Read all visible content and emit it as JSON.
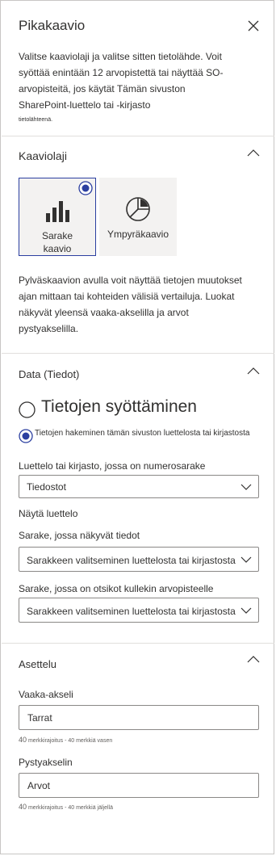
{
  "panel": {
    "title": "Pikakaavio",
    "close_icon": "close-icon",
    "intro_text": "Valitse kaaviolaji ja valitse sitten tietolähde. Voit syöttää enintään 12 arvopistettä tai näyttää SO-arvopisteitä, jos käytät Tämän sivuston SharePoint-luettelo tai -kirjasto",
    "intro_small": "tietolähteenä."
  },
  "chart_type": {
    "section_title": "Kaaviolaji",
    "options": [
      {
        "label_line1": "Sarake",
        "label_line2": "kaavio",
        "icon": "bar-chart-icon",
        "selected": true
      },
      {
        "label_line1": "Ympyräkaavio",
        "label_line2": "",
        "icon": "pie-chart-icon",
        "selected": false
      }
    ],
    "description": "Pylväskaavion avulla voit näyttää tietojen muutokset ajan mittaan tai kohteiden välisiä vertailuja. Luokat näkyvät yleensä vaaka-akselilla ja arvot pystyakselilla."
  },
  "data": {
    "section_title": "Data (Tiedot)",
    "radio_manual": "Tietojen syöttäminen",
    "radio_list": "Tietojen hakeminen tämän sivuston luettelosta tai kirjastosta",
    "list_label": "Luettelo tai kirjasto, jossa on numerosarake",
    "list_value": "Tiedostot",
    "show_list": "Näytä luettelo",
    "column_data_label": "Sarake, jossa näkyvät tiedot",
    "column_data_value": "Sarakkeen valitseminen luettelosta tai kirjastosta",
    "column_labels_label": "Sarake, jossa on otsikot kullekin arvopisteelle",
    "column_labels_value": "Sarakkeen valitseminen luettelosta tai kirjastosta"
  },
  "layout": {
    "section_title": "Asettelu",
    "x_axis_label": "Vaaka-akseli",
    "x_axis_value": "Tarrat",
    "x_counter_num": "40",
    "x_counter_text": "merkkirajoitus - 40 merkkiä vasen",
    "y_axis_label": "Pystyakselin",
    "y_axis_value": "Arvot",
    "y_counter_num": "40",
    "y_counter_text": "merkkirajoitus - 40 merkkiä jäljellä"
  },
  "colors": {
    "accent": "#2b3fa0",
    "border": "#8a8886",
    "tile_bg": "#f3f2f1",
    "text": "#323130"
  }
}
